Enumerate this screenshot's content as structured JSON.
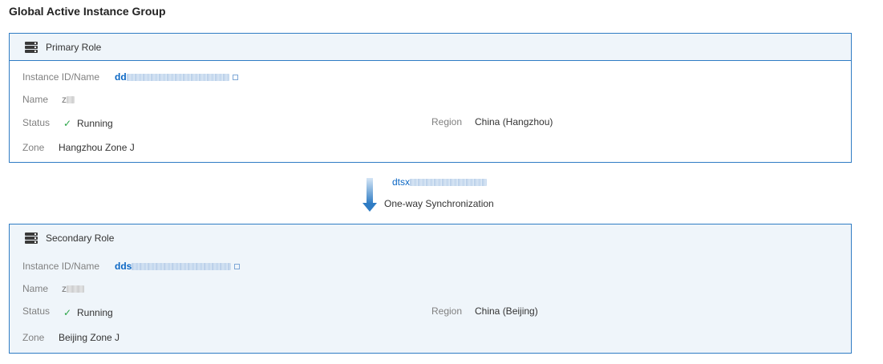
{
  "page": {
    "title": "Global Active Instance Group"
  },
  "primary": {
    "role_title": "Primary Role",
    "instance_label": "Instance ID/Name",
    "instance_id_prefix": "dd",
    "name_label": "Name",
    "name_prefix": "z",
    "status_label": "Status",
    "status_value": "Running",
    "region_label": "Region",
    "region_value": "China (Hangzhou)",
    "zone_label": "Zone",
    "zone_value": "Hangzhou Zone J"
  },
  "sync": {
    "task_id_prefix": "dtsx",
    "label": "One-way Synchronization"
  },
  "secondary": {
    "role_title": "Secondary Role",
    "instance_label": "Instance ID/Name",
    "instance_id_prefix": "dds",
    "name_label": "Name",
    "name_prefix": "z",
    "status_label": "Status",
    "status_value": "Running",
    "region_label": "Region",
    "region_value": "China (Beijing)",
    "zone_label": "Zone",
    "zone_value": "Beijing Zone J"
  },
  "icons": {
    "role_icon": "server-icon",
    "status_icon": "check-icon",
    "link_icon": "external-link-icon",
    "sync_icon": "down-arrow-icon"
  },
  "colors": {
    "accent": "#2f7cc4",
    "link": "#0b67c4",
    "success": "#2aa446",
    "panel_bg": "#eff5fa"
  }
}
